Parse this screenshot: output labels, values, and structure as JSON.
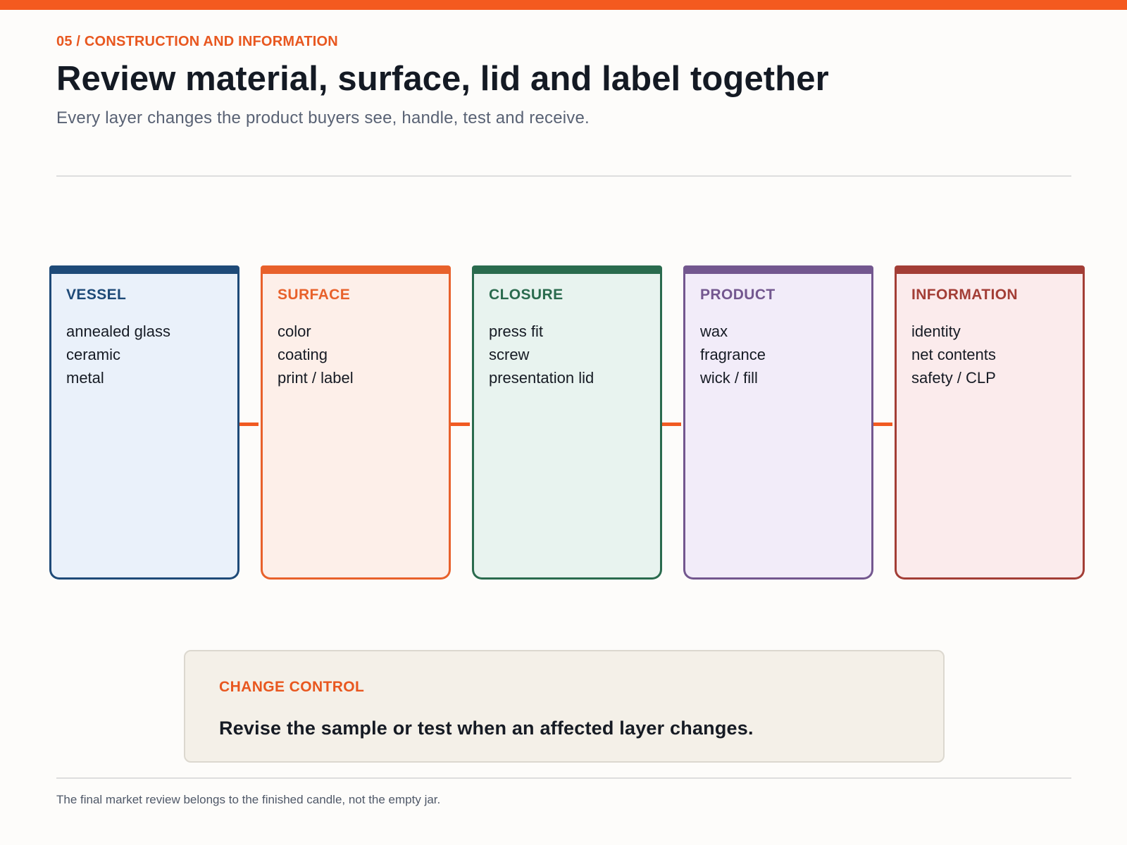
{
  "header": {
    "eyebrow": "05 / CONSTRUCTION AND INFORMATION",
    "title": "Review material, surface, lid and label together",
    "subtitle": "Every layer changes the product buyers see, handle, test and receive."
  },
  "layers": [
    {
      "title": "VESSEL",
      "color": "#1e4a78",
      "items": [
        "annealed glass",
        "ceramic",
        "metal"
      ]
    },
    {
      "title": "SURFACE",
      "color": "#e8612b",
      "items": [
        "color",
        "coating",
        "print / label"
      ]
    },
    {
      "title": "CLOSURE",
      "color": "#2a6b4e",
      "items": [
        "press fit",
        "screw",
        "presentation lid"
      ]
    },
    {
      "title": "PRODUCT",
      "color": "#73578f",
      "items": [
        "wax",
        "fragrance",
        "wick / fill"
      ]
    },
    {
      "title": "INFORMATION",
      "color": "#a33e36",
      "items": [
        "identity",
        "net contents",
        "safety / CLP"
      ]
    }
  ],
  "callout": {
    "label": "CHANGE CONTROL",
    "text": "Revise the sample or test when an affected layer changes."
  },
  "footer": {
    "note": "The final market review belongs to the finished candle, not the empty jar."
  },
  "colors": {
    "accent": "#f45a1f",
    "connector": "#f15a22"
  }
}
